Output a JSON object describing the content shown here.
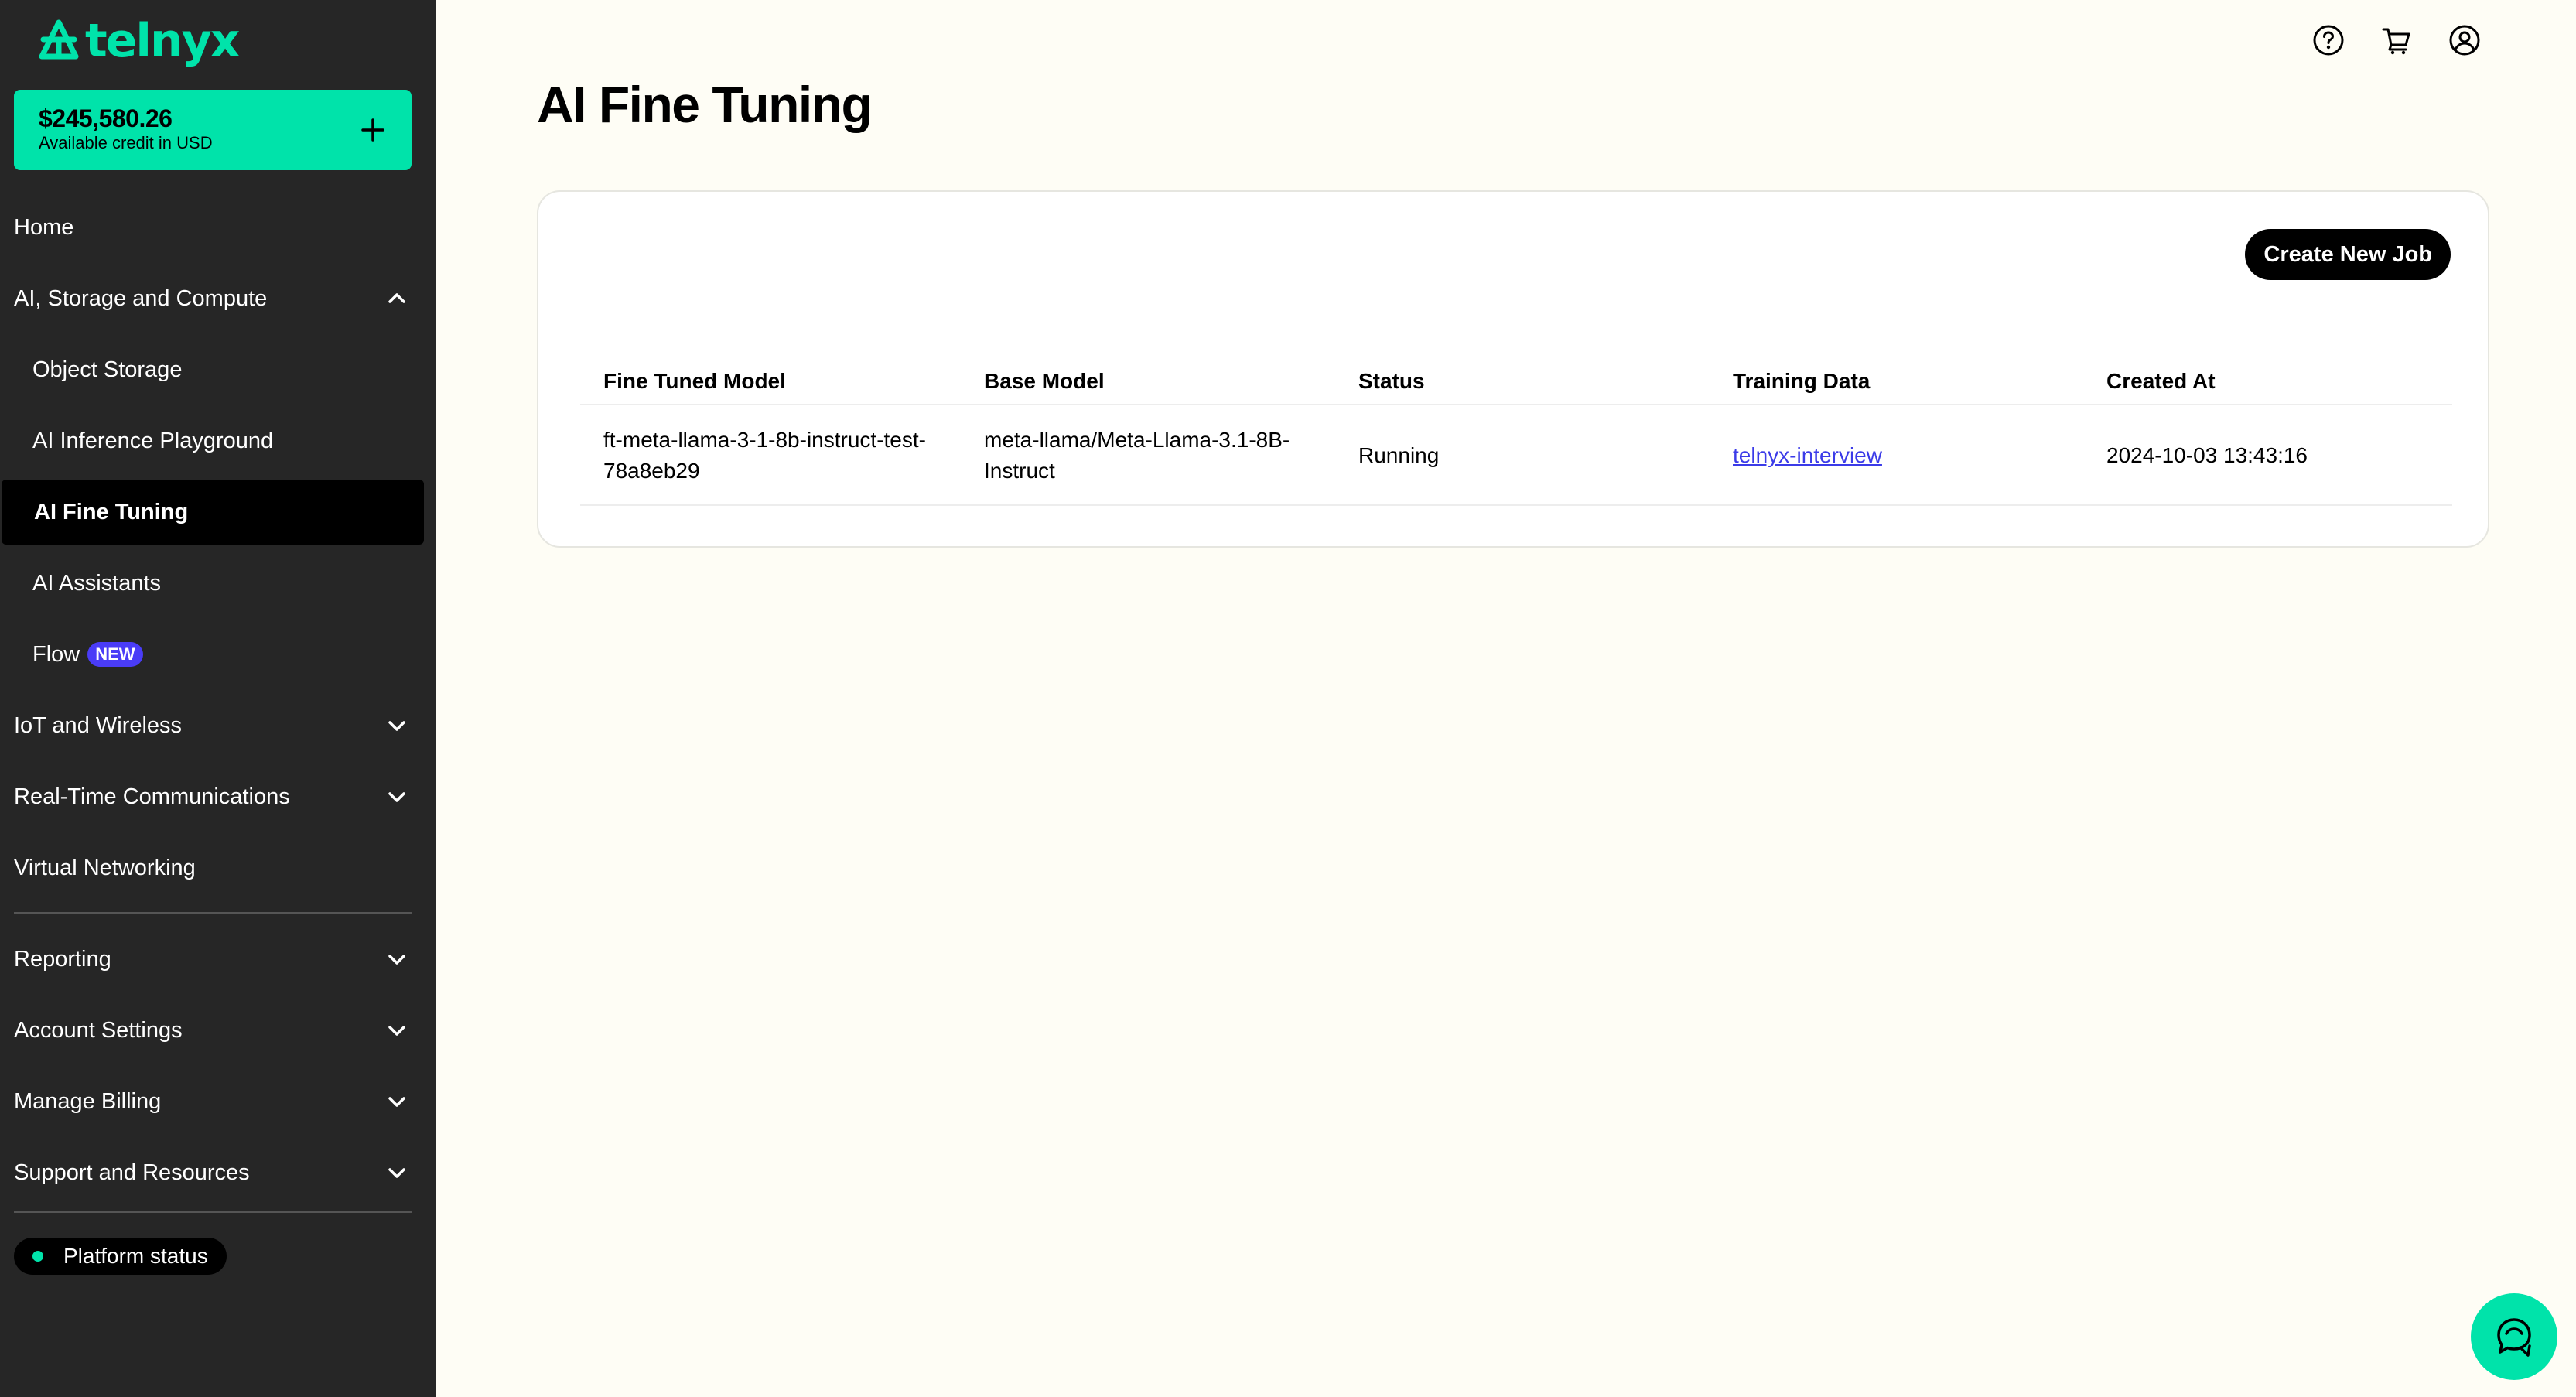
{
  "brand": {
    "name": "telnyx",
    "accent_color": "#00E3AA",
    "sidebar_bg": "#262626"
  },
  "credit": {
    "amount": "$245,580.26",
    "label": "Available credit in USD",
    "add_icon": "plus-icon"
  },
  "sidebar": {
    "items": [
      {
        "label": "Home",
        "level": "top",
        "expandable": false
      },
      {
        "label": "AI, Storage and Compute",
        "level": "top",
        "expandable": true,
        "expanded": true
      },
      {
        "label": "Object Storage",
        "level": "sub"
      },
      {
        "label": "AI Inference Playground",
        "level": "sub"
      },
      {
        "label": "AI Fine Tuning",
        "level": "sub",
        "active": true
      },
      {
        "label": "AI Assistants",
        "level": "sub"
      },
      {
        "label": "Flow",
        "level": "sub",
        "badge": "NEW"
      },
      {
        "label": "IoT and Wireless",
        "level": "top",
        "expandable": true,
        "expanded": false
      },
      {
        "label": "Real-Time Communications",
        "level": "top",
        "expandable": true,
        "expanded": false
      },
      {
        "label": "Virtual Networking",
        "level": "top",
        "expandable": false
      },
      {
        "label": "Reporting",
        "level": "top",
        "expandable": true,
        "expanded": false
      },
      {
        "label": "Account Settings",
        "level": "top",
        "expandable": true,
        "expanded": false
      },
      {
        "label": "Manage Billing",
        "level": "top",
        "expandable": true,
        "expanded": false
      },
      {
        "label": "Support and Resources",
        "level": "top",
        "expandable": true,
        "expanded": false
      }
    ],
    "platform_status": "Platform status",
    "status_color": "#00E3AA"
  },
  "header": {
    "icons": [
      "help-icon",
      "cart-icon",
      "account-icon"
    ]
  },
  "main": {
    "title": "AI Fine Tuning",
    "create_button": "Create New Job",
    "table": {
      "columns": [
        "Fine Tuned Model",
        "Base Model",
        "Status",
        "Training Data",
        "Created At"
      ],
      "rows": [
        {
          "fine_tuned_model": "ft-meta-llama-3-1-8b-instruct-test-78a8eb29",
          "base_model": "meta-llama/Meta-Llama-3.1-8B-Instruct",
          "status": "Running",
          "training_data": "telnyx-interview",
          "created_at": "2024-10-03 13:43:16"
        }
      ]
    }
  },
  "chat": {
    "icon": "chat-support-icon"
  }
}
